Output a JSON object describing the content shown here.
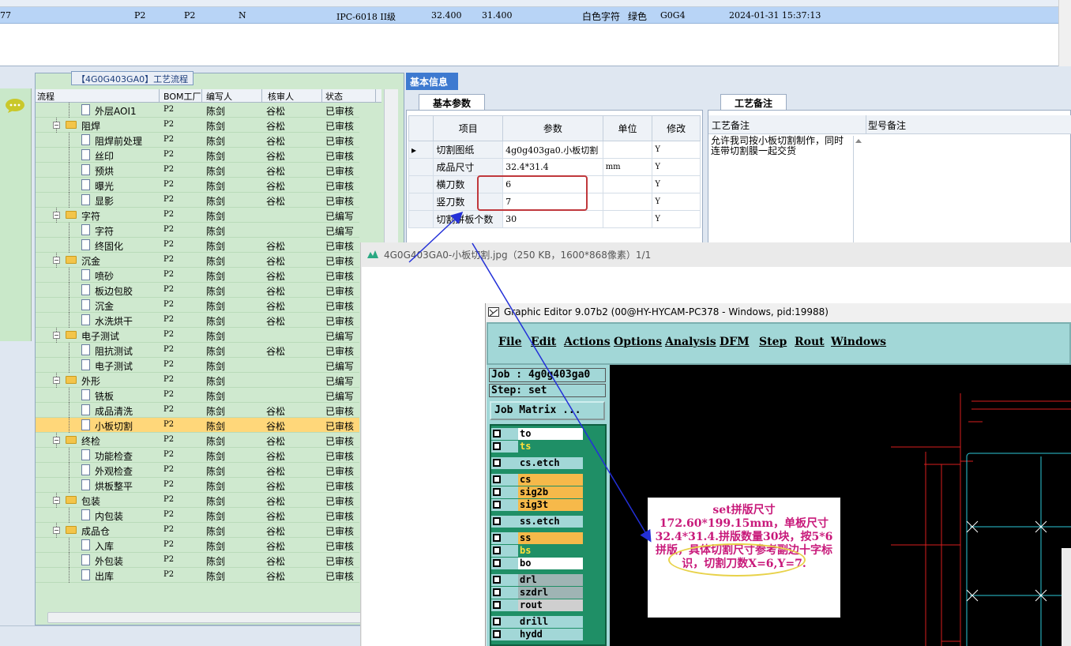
{
  "top_row": {
    "id": "77",
    "col1": "P2",
    "col2": "P2",
    "col3": "N",
    "grade": "IPC-6018 II级",
    "width": "32.400",
    "height": "31.400",
    "text_color": "白色字符",
    "mask_color": "绿色",
    "code": "G0G4",
    "datetime": "2024-01-31 15:37:13"
  },
  "tree": {
    "title": "【4G0G403GA0】工艺流程",
    "headers": {
      "flow": "流程",
      "factory": "BOM工厂",
      "writer": "编写人",
      "reviewer": "核审人",
      "status": "状态"
    },
    "rows": [
      {
        "name": "外层AOI1",
        "level": 2,
        "factory": "P2",
        "writer": "陈剑",
        "reviewer": "谷松",
        "status": "已审核"
      },
      {
        "name": "阻焊",
        "level": 1,
        "factory": "P2",
        "writer": "陈剑",
        "reviewer": "谷松",
        "status": "已审核"
      },
      {
        "name": "阻焊前处理",
        "level": 2,
        "factory": "P2",
        "writer": "陈剑",
        "reviewer": "谷松",
        "status": "已审核"
      },
      {
        "name": "丝印",
        "level": 2,
        "factory": "P2",
        "writer": "陈剑",
        "reviewer": "谷松",
        "status": "已审核"
      },
      {
        "name": "预烘",
        "level": 2,
        "factory": "P2",
        "writer": "陈剑",
        "reviewer": "谷松",
        "status": "已审核"
      },
      {
        "name": "曝光",
        "level": 2,
        "factory": "P2",
        "writer": "陈剑",
        "reviewer": "谷松",
        "status": "已审核"
      },
      {
        "name": "显影",
        "level": 2,
        "factory": "P2",
        "writer": "陈剑",
        "reviewer": "谷松",
        "status": "已审核"
      },
      {
        "name": "字符",
        "level": 1,
        "factory": "P2",
        "writer": "陈剑",
        "reviewer": "",
        "status": "已编写"
      },
      {
        "name": "字符",
        "level": 2,
        "factory": "P2",
        "writer": "陈剑",
        "reviewer": "",
        "status": "已编写"
      },
      {
        "name": "终固化",
        "level": 2,
        "factory": "P2",
        "writer": "陈剑",
        "reviewer": "谷松",
        "status": "已审核"
      },
      {
        "name": "沉金",
        "level": 1,
        "factory": "P2",
        "writer": "陈剑",
        "reviewer": "谷松",
        "status": "已审核"
      },
      {
        "name": "喷砂",
        "level": 2,
        "factory": "P2",
        "writer": "陈剑",
        "reviewer": "谷松",
        "status": "已审核"
      },
      {
        "name": "板边包胶",
        "level": 2,
        "factory": "P2",
        "writer": "陈剑",
        "reviewer": "谷松",
        "status": "已审核"
      },
      {
        "name": "沉金",
        "level": 2,
        "factory": "P2",
        "writer": "陈剑",
        "reviewer": "谷松",
        "status": "已审核"
      },
      {
        "name": "水洗烘干",
        "level": 2,
        "factory": "P2",
        "writer": "陈剑",
        "reviewer": "谷松",
        "status": "已审核"
      },
      {
        "name": "电子测试",
        "level": 1,
        "factory": "P2",
        "writer": "陈剑",
        "reviewer": "",
        "status": "已编写"
      },
      {
        "name": "阻抗测试",
        "level": 2,
        "factory": "P2",
        "writer": "陈剑",
        "reviewer": "谷松",
        "status": "已审核"
      },
      {
        "name": "电子测试",
        "level": 2,
        "factory": "P2",
        "writer": "陈剑",
        "reviewer": "",
        "status": "已编写"
      },
      {
        "name": "外形",
        "level": 1,
        "factory": "P2",
        "writer": "陈剑",
        "reviewer": "",
        "status": "已编写"
      },
      {
        "name": "铣板",
        "level": 2,
        "factory": "P2",
        "writer": "陈剑",
        "reviewer": "",
        "status": "已编写"
      },
      {
        "name": "成品清洗",
        "level": 2,
        "factory": "P2",
        "writer": "陈剑",
        "reviewer": "谷松",
        "status": "已审核"
      },
      {
        "name": "小板切割",
        "level": 2,
        "factory": "P2",
        "writer": "陈剑",
        "reviewer": "谷松",
        "status": "已审核",
        "selected": true
      },
      {
        "name": "终检",
        "level": 1,
        "factory": "P2",
        "writer": "陈剑",
        "reviewer": "谷松",
        "status": "已审核"
      },
      {
        "name": "功能检查",
        "level": 2,
        "factory": "P2",
        "writer": "陈剑",
        "reviewer": "谷松",
        "status": "已审核"
      },
      {
        "name": "外观检查",
        "level": 2,
        "factory": "P2",
        "writer": "陈剑",
        "reviewer": "谷松",
        "status": "已审核"
      },
      {
        "name": "烘板整平",
        "level": 2,
        "factory": "P2",
        "writer": "陈剑",
        "reviewer": "谷松",
        "status": "已审核"
      },
      {
        "name": "包装",
        "level": 1,
        "factory": "P2",
        "writer": "陈剑",
        "reviewer": "谷松",
        "status": "已审核"
      },
      {
        "name": "内包装",
        "level": 2,
        "factory": "P2",
        "writer": "陈剑",
        "reviewer": "谷松",
        "status": "已审核"
      },
      {
        "name": "成品仓",
        "level": 1,
        "factory": "P2",
        "writer": "陈剑",
        "reviewer": "谷松",
        "status": "已审核"
      },
      {
        "name": "入库",
        "level": 2,
        "factory": "P2",
        "writer": "陈剑",
        "reviewer": "谷松",
        "status": "已审核"
      },
      {
        "name": "外包装",
        "level": 2,
        "factory": "P2",
        "writer": "陈剑",
        "reviewer": "谷松",
        "status": "已审核"
      },
      {
        "name": "出库",
        "level": 2,
        "factory": "P2",
        "writer": "陈剑",
        "reviewer": "谷松",
        "status": "已审核"
      }
    ]
  },
  "info": {
    "tab": "基本信息",
    "basic_tab": "基本参数",
    "headers": {
      "item": "项目",
      "param": "参数",
      "unit": "单位",
      "modify": "修改"
    },
    "rows": [
      {
        "item": "切割图纸",
        "param": "4g0g403ga0.小板切割",
        "unit": "",
        "modify": "Y"
      },
      {
        "item": "成品尺寸",
        "param": "32.4*31.4",
        "unit": "mm",
        "modify": "Y"
      },
      {
        "item": "横刀数",
        "param": "6",
        "unit": "",
        "modify": "Y"
      },
      {
        "item": "竖刀数",
        "param": "7",
        "unit": "",
        "modify": "Y"
      },
      {
        "item": "切割拼板个数",
        "param": "30",
        "unit": "",
        "modify": "Y"
      }
    ],
    "row_marker": "▸"
  },
  "remarks": {
    "tab": "工艺备注",
    "col1": "工艺备注",
    "col2": "型号备注",
    "text": "允许我司按小板切割制作，同时连带切割膜一起交货"
  },
  "viewer": {
    "title": "4G0G403GA0-小板切割.jpg（250 KB，1600*868像素）1/1"
  },
  "graphic_editor": {
    "title": "Graphic Editor 9.07b2 (00@HY-HYCAM-PC378 - Windows, pid:19988)",
    "menus": [
      "File",
      "Edit",
      "Actions",
      "Options",
      "Analysis",
      "DFM",
      "Step",
      "Rout",
      "Windows"
    ],
    "job": "Job : 4g0g403ga0",
    "step": "Step: set",
    "job_matrix": "Job Matrix ...",
    "layers": [
      {
        "name": "to",
        "color": "#ffffff"
      },
      {
        "name": "ts",
        "color": "#1f8f66"
      },
      {
        "name": "cs.etch",
        "color": "#a2d7d7"
      },
      {
        "name": "cs",
        "color": "#f6b94a"
      },
      {
        "name": "sig2b",
        "color": "#f6b94a"
      },
      {
        "name": "sig3t",
        "color": "#f6b94a"
      },
      {
        "name": "ss.etch",
        "color": "#a2d7d7"
      },
      {
        "name": "ss",
        "color": "#f6b94a"
      },
      {
        "name": "bs",
        "color": "#1f8f66"
      },
      {
        "name": "bo",
        "color": "#ffffff"
      },
      {
        "name": "drl",
        "color": "#9fb4b4"
      },
      {
        "name": "szdrl",
        "color": "#9fb4b4"
      },
      {
        "name": "rout",
        "color": "#cfcfcf"
      },
      {
        "name": "drill",
        "color": "#a2d7d7"
      },
      {
        "name": "hydd",
        "color": "#a2d7d7"
      }
    ]
  },
  "note": {
    "text": "set拼版尺寸172.60*199.15mm，单板尺寸32.4*31.4.拼版数量30块，按5*6拼版，具体切割尺寸参考副边十字标识，切割刀数X=6,Y=7."
  }
}
